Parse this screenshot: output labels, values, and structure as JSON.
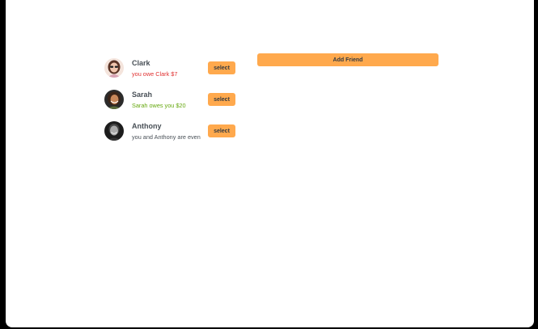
{
  "friends": [
    {
      "name": "Clark",
      "balance_text": "you owe Clark $7",
      "balance_status": "owe",
      "status_color": "#e03131",
      "avatar_icon": "clark-avatar-icon",
      "select_label": "select"
    },
    {
      "name": "Sarah",
      "balance_text": "Sarah owes you $20",
      "balance_status": "owed",
      "status_color": "#66a80f",
      "avatar_icon": "sarah-avatar-icon",
      "select_label": "select"
    },
    {
      "name": "Anthony",
      "balance_text": "you and Anthony are even",
      "balance_status": "even",
      "status_color": "#495057",
      "avatar_icon": "anthony-avatar-icon",
      "select_label": "select"
    }
  ],
  "add_friend": {
    "label": "Add Friend"
  },
  "colors": {
    "accent": "#ffa94d",
    "text": "#343a40",
    "owe": "#e03131",
    "owed": "#66a80f"
  }
}
